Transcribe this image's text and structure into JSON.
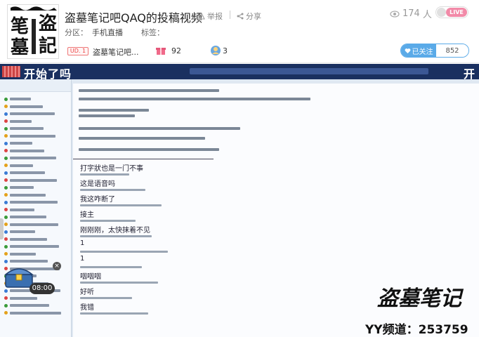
{
  "streamer": {
    "title": "盗墓笔记吧QAQ的投稿视频",
    "avatar_text": [
      "盗",
      "墓",
      "笔",
      "記"
    ],
    "category_label": "分区：",
    "category_value": "手机直播",
    "tags_label": "标签："
  },
  "actions": {
    "report_label": "举报",
    "share_label": "分享"
  },
  "viewers": {
    "count": "174",
    "unit": "人"
  },
  "live_badge": "LIVE",
  "guild": {
    "level": "UD. 1",
    "name": "盗墓笔记吧..."
  },
  "gifts": {
    "count": "92"
  },
  "fans": {
    "count": "3"
  },
  "follow": {
    "label": "已关注",
    "count": "852"
  },
  "video": {
    "banner_text": "开始了吗",
    "banner_text_cut": "开",
    "chest_timer": "08:00",
    "chest_close": "×",
    "logo_text": "盗墓笔记",
    "channel_text": "YY频道：253759",
    "chat_large": [
      "打字狀也是一门不事",
      "这是语音吗",
      "我这咋断了",
      "接主",
      "刚刚刚，太快抹着不见",
      "1",
      "1",
      "咽咽咽",
      "好听",
      "我错"
    ]
  }
}
